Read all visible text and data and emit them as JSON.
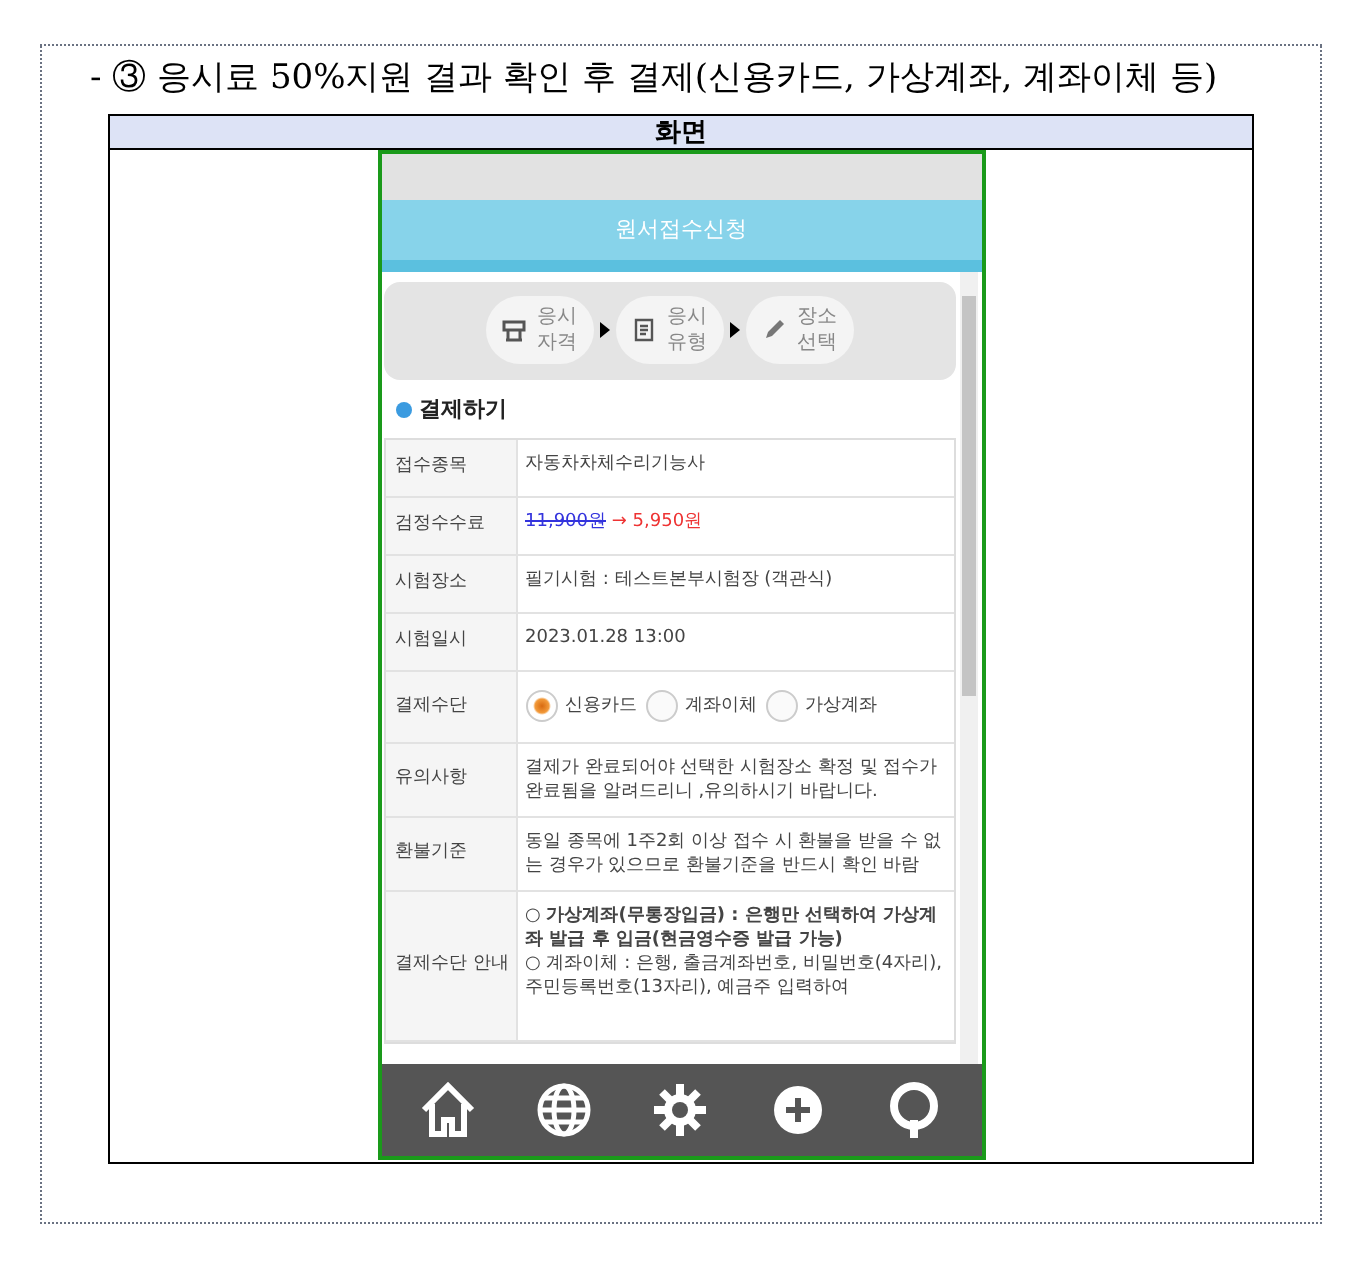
{
  "heading": "- ③ 응시료 50%지원 결과 확인 후 결제(신용카드, 가상계좌, 계좌이체 등)",
  "table_header": "화면",
  "phone": {
    "header_title": "원서접수신청",
    "steps": [
      {
        "lines": [
          "응시",
          "자격"
        ]
      },
      {
        "lines": [
          "응시",
          "유형"
        ]
      },
      {
        "lines": [
          "장소",
          "선택"
        ]
      }
    ],
    "section_title": "결제하기",
    "rows": [
      {
        "kind": "text",
        "label": "접수종목",
        "value": "자동차차체수리기능사"
      },
      {
        "kind": "fee",
        "label": "검정수수료",
        "original": "11,900원",
        "arrow": "→",
        "discounted": "5,950원"
      },
      {
        "kind": "text",
        "label": "시험장소",
        "value": "필기시험 : 테스트본부시험장 (객관식)"
      },
      {
        "kind": "text",
        "label": "시험일시",
        "value": "2023.01.28 13:00"
      },
      {
        "kind": "radio",
        "label": "결제수단",
        "options": [
          {
            "label": "신용카드",
            "selected": true
          },
          {
            "label": "계좌이체",
            "selected": false
          },
          {
            "label": "가상계좌",
            "selected": false
          }
        ]
      },
      {
        "kind": "text",
        "label": "유의사항",
        "value": "결제가 완료되어야 선택한 시험장소 확정 및 접수가 완료됨을 알려드리니 ,유의하시기 바랍니다."
      },
      {
        "kind": "text",
        "label": "환불기준",
        "value": "동일 종목에 1주2회 이상 접수 시 환불을 받을 수 없는 경우가 있으므로 환불기준을 반드시 확인 바람"
      },
      {
        "kind": "guide",
        "label": "결제수단 안내",
        "lines": [
          "○ **가상계좌(무통장입금) : 은행만 선택하여 가상계좌 발급 후 입금(현금영수증 발급 가능)**",
          "○ 계좌이체 : 은행, 출금계좌번호, 비밀번호(4자리), 주민등록번호(13자리), 예금주 입력하여"
        ]
      }
    ]
  }
}
